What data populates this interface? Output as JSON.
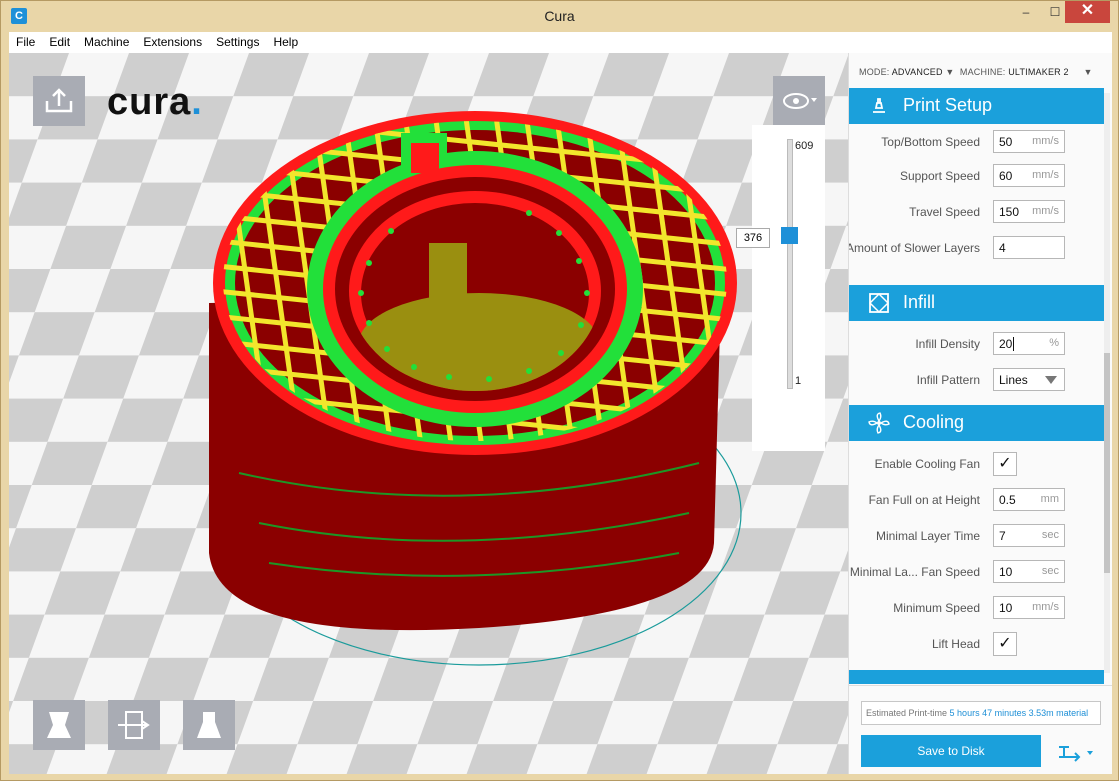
{
  "window": {
    "title": "Cura",
    "minimize": "‒",
    "maximize": "☐",
    "close": "✕"
  },
  "menu": [
    "File",
    "Edit",
    "Machine",
    "Extensions",
    "Settings",
    "Help"
  ],
  "logo": {
    "text": "cura",
    "dot": "."
  },
  "layers": {
    "max": "609",
    "current": "376",
    "min": "1",
    "position_fraction": 0.617
  },
  "mode": {
    "mode_label": "MODE:",
    "mode_value": "ADVANCED",
    "machine_label": "MACHINE:",
    "machine_value": "ULTIMAKER 2"
  },
  "sections": {
    "print_setup": {
      "label": "Print Setup",
      "icon": "printer-icon"
    },
    "infill": {
      "label": "Infill",
      "icon": "infill-icon"
    },
    "cooling": {
      "label": "Cooling",
      "icon": "fan-icon"
    }
  },
  "print_setup_rows": [
    {
      "label": "Top/Bottom Speed",
      "value": "50",
      "unit": "mm/s"
    },
    {
      "label": "Support Speed",
      "value": "60",
      "unit": "mm/s"
    },
    {
      "label": "Travel Speed",
      "value": "150",
      "unit": "mm/s"
    },
    {
      "label": "Amount of Slower Layers",
      "value": "4",
      "unit": ""
    }
  ],
  "infill_rows": {
    "density": {
      "label": "Infill Density",
      "value": "20",
      "unit": "%"
    },
    "pattern": {
      "label": "Infill Pattern",
      "value": "Lines"
    }
  },
  "cooling_rows": {
    "enable_fan": {
      "label": "Enable Cooling Fan",
      "checked": "✓"
    },
    "fan_full_height": {
      "label": "Fan Full on at Height",
      "value": "0.5",
      "unit": "mm"
    },
    "min_layer_time": {
      "label": "Minimal Layer Time",
      "value": "7",
      "unit": "sec"
    },
    "min_layer_fan": {
      "label": "Minimal La... Fan Speed",
      "value": "10",
      "unit": "sec"
    },
    "min_speed": {
      "label": "Minimum Speed",
      "value": "10",
      "unit": "mm/s"
    },
    "lift_head": {
      "label": "Lift Head",
      "checked": "✓"
    }
  },
  "estimate": {
    "label": "Estimated Print-time",
    "time": "5 hours 47 minutes",
    "material": "3.53m material"
  },
  "save_button": "Save to Disk",
  "tools": [
    "scale-icon",
    "rotate-icon",
    "mirror-icon"
  ],
  "colors": {
    "accent": "#1ba0db",
    "wall": "#8b0000",
    "outer": "#ff1a1a",
    "shell": "#22e03a",
    "infill": "#f2e62c"
  }
}
